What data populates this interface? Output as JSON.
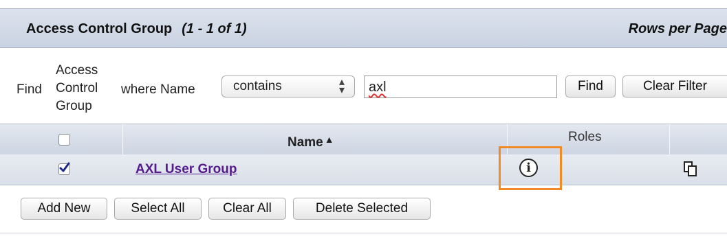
{
  "header": {
    "title": "Access Control Group",
    "range": "(1 - 1 of 1)",
    "rows_per_page": "Rows per Page"
  },
  "filter": {
    "find_label": "Find",
    "field_label": "Access Control Group",
    "where_label": "where Name",
    "operator": "contains",
    "value": "axl",
    "find_button": "Find",
    "clear_filter_button": "Clear Filter"
  },
  "table": {
    "columns": [
      "",
      "Name",
      "Roles",
      ""
    ],
    "sort_indicator": "▲",
    "rows": [
      {
        "checked": true,
        "name": "AXL User Group",
        "roles_icon": "info-icon",
        "action_icon": "copy-icon"
      }
    ]
  },
  "actions": {
    "add_new": "Add New",
    "select_all": "Select All",
    "clear_all": "Clear All",
    "delete_selected": "Delete Selected"
  },
  "colors": {
    "highlight": "#f28a26",
    "link": "#551a8b"
  }
}
